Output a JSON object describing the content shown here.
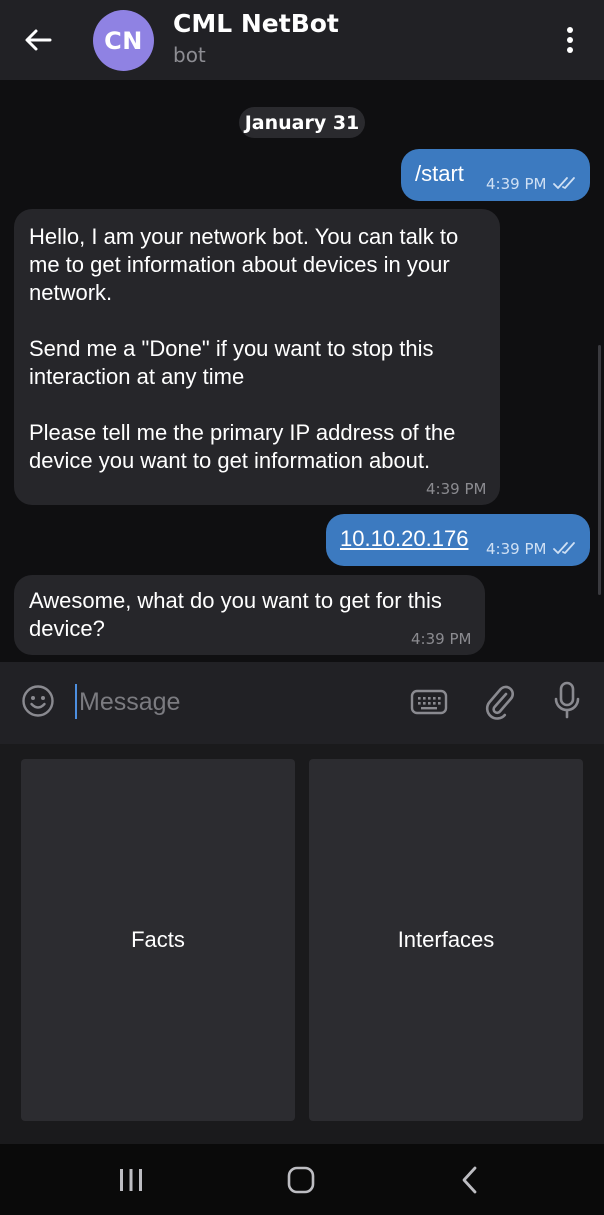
{
  "header": {
    "title": "CML NetBot",
    "subtitle": "bot",
    "avatar_initials": "CN",
    "avatar_color": "#8f82e3",
    "back_icon": "arrow-left-icon",
    "menu_icon": "more-vertical-icon"
  },
  "chat": {
    "date": "January 31",
    "messages": [
      {
        "direction": "outgoing",
        "text": "/start",
        "time": "4:39 PM",
        "status": "read"
      },
      {
        "direction": "incoming",
        "text": "Hello, I am your network bot. You can talk to\nme to get information about devices in your\nnetwork.\n\nSend me a \"Done\" if you want to stop this\ninteraction at any time\n\nPlease tell me the primary IP address of the\ndevice you want to get information about.",
        "time": "4:39 PM"
      },
      {
        "direction": "outgoing",
        "text": "10.10.20.176",
        "time": "4:39 PM",
        "status": "read",
        "is_link": true
      },
      {
        "direction": "incoming",
        "text": "Awesome, what do you want to get for this\ndevice?",
        "time": "4:39 PM"
      }
    ]
  },
  "composer": {
    "placeholder": "Message",
    "value": "",
    "emoji_icon": "emoji-icon",
    "keyboard_icon": "keyboard-icon",
    "attach_icon": "paperclip-icon",
    "mic_icon": "microphone-icon"
  },
  "reply_keyboard": {
    "buttons": [
      {
        "label": "Facts"
      },
      {
        "label": "Interfaces"
      }
    ]
  },
  "navigation": {
    "recents_icon": "recents-icon",
    "home_icon": "home-icon",
    "back_icon": "nav-back-icon"
  },
  "colors": {
    "outgoing_bubble": "#3c7ac0",
    "incoming_bubble": "#26262a",
    "header_bg": "#212125",
    "chat_bg": "#0f0f11",
    "accent": "#4d8fe0"
  }
}
